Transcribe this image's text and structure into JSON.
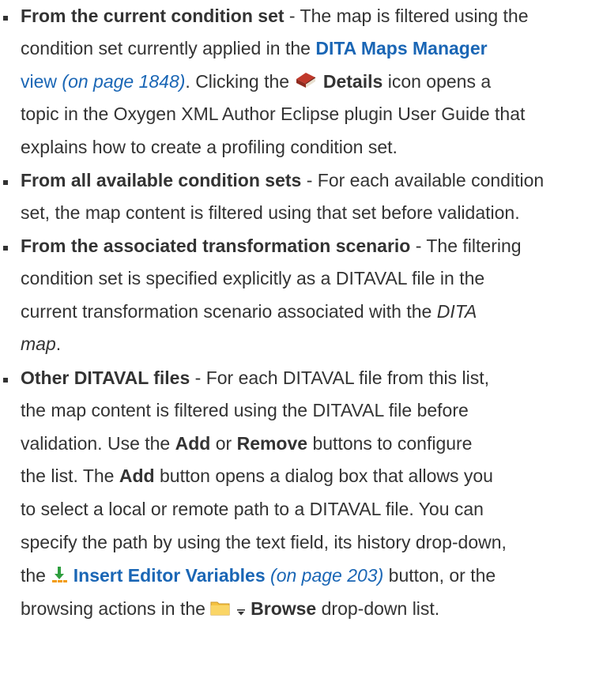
{
  "items": [
    {
      "title": "From the current condition set",
      "text1": " - The map is filtered using the",
      "text2": "condition set currently applied in the ",
      "link1": "DITA Maps Manager",
      "link1b": "view",
      "page_ref1": "(on page 1848)",
      "text3": ". Clicking the ",
      "details_icon": "book-icon",
      "details_label": "Details",
      "text4": " icon opens a",
      "text5": "topic in the Oxygen XML Author Eclipse plugin User Guide that",
      "text6": "explains how to create a profiling condition set."
    },
    {
      "title": "From all available condition sets",
      "text1": " - For each available condition",
      "text2": "set, the map content is filtered using that set before validation."
    },
    {
      "title": "From the associated transformation scenario",
      "text1": " - The filtering",
      "text2": "condition set is specified explicitly as a DITAVAL file in the",
      "text3": "current transformation scenario associated with the ",
      "italic1": "DITA",
      "italic2": "map",
      "text4": "."
    },
    {
      "title": "Other DITAVAL files",
      "text1": " - For each DITAVAL file from this list,",
      "text2": "the map content is filtered using the DITAVAL file before",
      "text3": "validation. Use the ",
      "add_label": "Add",
      "text4": " or ",
      "remove_label": "Remove",
      "text5": " buttons to configure",
      "text6": "the list. The ",
      "add_label2": "Add",
      "text7": " button opens a dialog box that allows you",
      "text8": "to select a local or remote path to a DITAVAL file. You can",
      "text9": "specify the path by using the text field, its history drop-down,",
      "text10": "the ",
      "insert_icon": "insert-variables-icon",
      "insert_link": "Insert Editor Variables",
      "page_ref2": "(on page 203)",
      "text11": " button, or the",
      "text12": "browsing actions in the ",
      "folder_icon": "folder-icon",
      "dropdown_icon": "dropdown-arrow-icon",
      "browse_label": "Browse",
      "text13": " drop-down list."
    }
  ]
}
